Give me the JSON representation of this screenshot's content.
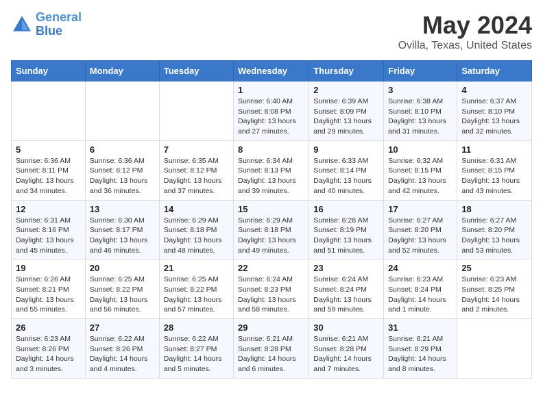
{
  "header": {
    "logo_line1": "General",
    "logo_line2": "Blue",
    "month_title": "May 2024",
    "location": "Ovilla, Texas, United States"
  },
  "days_of_week": [
    "Sunday",
    "Monday",
    "Tuesday",
    "Wednesday",
    "Thursday",
    "Friday",
    "Saturday"
  ],
  "weeks": [
    [
      {
        "day": "",
        "info": ""
      },
      {
        "day": "",
        "info": ""
      },
      {
        "day": "",
        "info": ""
      },
      {
        "day": "1",
        "info": "Sunrise: 6:40 AM\nSunset: 8:08 PM\nDaylight: 13 hours\nand 27 minutes."
      },
      {
        "day": "2",
        "info": "Sunrise: 6:39 AM\nSunset: 8:09 PM\nDaylight: 13 hours\nand 29 minutes."
      },
      {
        "day": "3",
        "info": "Sunrise: 6:38 AM\nSunset: 8:10 PM\nDaylight: 13 hours\nand 31 minutes."
      },
      {
        "day": "4",
        "info": "Sunrise: 6:37 AM\nSunset: 8:10 PM\nDaylight: 13 hours\nand 32 minutes."
      }
    ],
    [
      {
        "day": "5",
        "info": "Sunrise: 6:36 AM\nSunset: 8:11 PM\nDaylight: 13 hours\nand 34 minutes."
      },
      {
        "day": "6",
        "info": "Sunrise: 6:36 AM\nSunset: 8:12 PM\nDaylight: 13 hours\nand 36 minutes."
      },
      {
        "day": "7",
        "info": "Sunrise: 6:35 AM\nSunset: 8:12 PM\nDaylight: 13 hours\nand 37 minutes."
      },
      {
        "day": "8",
        "info": "Sunrise: 6:34 AM\nSunset: 8:13 PM\nDaylight: 13 hours\nand 39 minutes."
      },
      {
        "day": "9",
        "info": "Sunrise: 6:33 AM\nSunset: 8:14 PM\nDaylight: 13 hours\nand 40 minutes."
      },
      {
        "day": "10",
        "info": "Sunrise: 6:32 AM\nSunset: 8:15 PM\nDaylight: 13 hours\nand 42 minutes."
      },
      {
        "day": "11",
        "info": "Sunrise: 6:31 AM\nSunset: 8:15 PM\nDaylight: 13 hours\nand 43 minutes."
      }
    ],
    [
      {
        "day": "12",
        "info": "Sunrise: 6:31 AM\nSunset: 8:16 PM\nDaylight: 13 hours\nand 45 minutes."
      },
      {
        "day": "13",
        "info": "Sunrise: 6:30 AM\nSunset: 8:17 PM\nDaylight: 13 hours\nand 46 minutes."
      },
      {
        "day": "14",
        "info": "Sunrise: 6:29 AM\nSunset: 8:18 PM\nDaylight: 13 hours\nand 48 minutes."
      },
      {
        "day": "15",
        "info": "Sunrise: 6:29 AM\nSunset: 8:18 PM\nDaylight: 13 hours\nand 49 minutes."
      },
      {
        "day": "16",
        "info": "Sunrise: 6:28 AM\nSunset: 8:19 PM\nDaylight: 13 hours\nand 51 minutes."
      },
      {
        "day": "17",
        "info": "Sunrise: 6:27 AM\nSunset: 8:20 PM\nDaylight: 13 hours\nand 52 minutes."
      },
      {
        "day": "18",
        "info": "Sunrise: 6:27 AM\nSunset: 8:20 PM\nDaylight: 13 hours\nand 53 minutes."
      }
    ],
    [
      {
        "day": "19",
        "info": "Sunrise: 6:26 AM\nSunset: 8:21 PM\nDaylight: 13 hours\nand 55 minutes."
      },
      {
        "day": "20",
        "info": "Sunrise: 6:25 AM\nSunset: 8:22 PM\nDaylight: 13 hours\nand 56 minutes."
      },
      {
        "day": "21",
        "info": "Sunrise: 6:25 AM\nSunset: 8:22 PM\nDaylight: 13 hours\nand 57 minutes."
      },
      {
        "day": "22",
        "info": "Sunrise: 6:24 AM\nSunset: 8:23 PM\nDaylight: 13 hours\nand 58 minutes."
      },
      {
        "day": "23",
        "info": "Sunrise: 6:24 AM\nSunset: 8:24 PM\nDaylight: 13 hours\nand 59 minutes."
      },
      {
        "day": "24",
        "info": "Sunrise: 6:23 AM\nSunset: 8:24 PM\nDaylight: 14 hours\nand 1 minute."
      },
      {
        "day": "25",
        "info": "Sunrise: 6:23 AM\nSunset: 8:25 PM\nDaylight: 14 hours\nand 2 minutes."
      }
    ],
    [
      {
        "day": "26",
        "info": "Sunrise: 6:23 AM\nSunset: 8:26 PM\nDaylight: 14 hours\nand 3 minutes."
      },
      {
        "day": "27",
        "info": "Sunrise: 6:22 AM\nSunset: 8:26 PM\nDaylight: 14 hours\nand 4 minutes."
      },
      {
        "day": "28",
        "info": "Sunrise: 6:22 AM\nSunset: 8:27 PM\nDaylight: 14 hours\nand 5 minutes."
      },
      {
        "day": "29",
        "info": "Sunrise: 6:21 AM\nSunset: 8:28 PM\nDaylight: 14 hours\nand 6 minutes."
      },
      {
        "day": "30",
        "info": "Sunrise: 6:21 AM\nSunset: 8:28 PM\nDaylight: 14 hours\nand 7 minutes."
      },
      {
        "day": "31",
        "info": "Sunrise: 6:21 AM\nSunset: 8:29 PM\nDaylight: 14 hours\nand 8 minutes."
      },
      {
        "day": "",
        "info": ""
      }
    ]
  ]
}
